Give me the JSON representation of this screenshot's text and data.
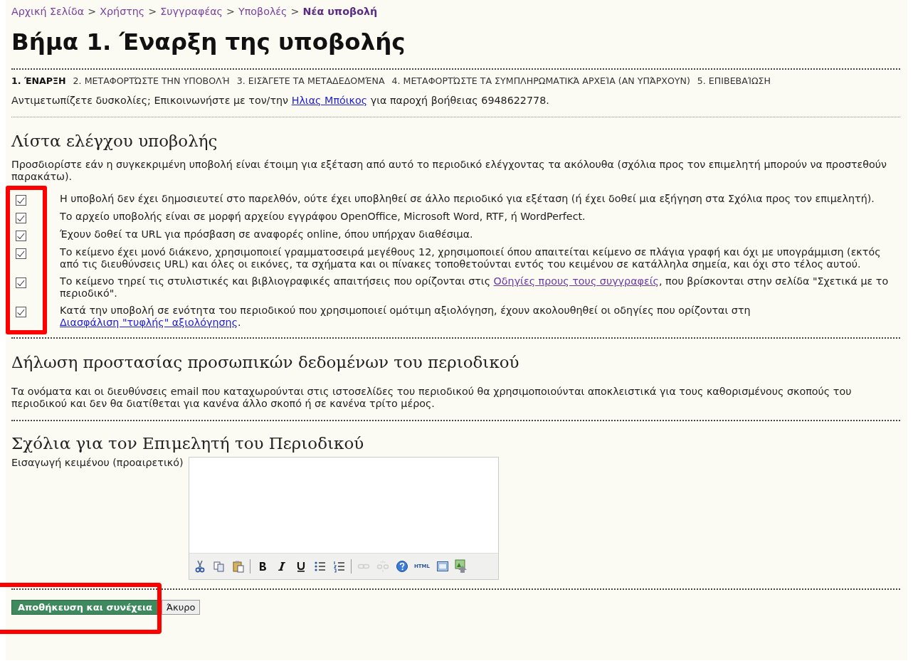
{
  "breadcrumb": [
    {
      "label": "Αρχική Σελίδα",
      "current": false
    },
    {
      "label": "Χρήστης",
      "current": false
    },
    {
      "label": "Συγγραφέας",
      "current": false
    },
    {
      "label": "Υποβολές",
      "current": false
    },
    {
      "label": "Νέα υποβολή",
      "current": true
    }
  ],
  "breadcrumb_separator": ">",
  "title": "Βήμα 1. Έναρξη της υποβολής",
  "steps": [
    {
      "label": "1. ΈΝΑΡΞΗ",
      "selected": true
    },
    {
      "label": "2. ΜΕΤΑΦΟΡΤΏΣΤΕ ΤΗΝ ΥΠΟΒΟΛΉ",
      "selected": false
    },
    {
      "label": "3. ΕΙΣΆΓΕΤΕ ΤΑ ΜΕΤΑΔΕΔΟΜΈΝΑ",
      "selected": false
    },
    {
      "label": "4. ΜΕΤΑΦΟΡΤΏΣΤΕ ΤΑ ΣΥΜΠΛΗΡΩΜΑΤΙΚΆ ΑΡΧΕΊΑ (ΑΝ ΥΠΆΡΧΟΥΝ)",
      "selected": false
    },
    {
      "label": "5. ΕΠΙΒΕΒΑΊΩΣΗ",
      "selected": false
    }
  ],
  "help": {
    "before": "Αντιμετωπίζετε δυσκολίες; Επικοινωνήστε με τον/την",
    "link": "Ηλιας Μπόικος",
    "after": "για παροχή βοήθειας 6948622778."
  },
  "checklist": {
    "heading": "Λίστα ελέγχου υποβολής",
    "intro": "Προσδιορίστε εάν η συγκεκριμένη υποβολή είναι έτοιμη για εξέταση από αυτό το περιοδικό ελέγχοντας τα ακόλουθα (σχόλια προς τον επιμελητή μπορούν να προστεθούν παρακάτω).",
    "highlighted": true,
    "items": [
      {
        "checked": true,
        "before": "Η υποβολή δεν έχει δημοσιευτεί στο παρελθόν, ούτε έχει υποβληθεί σε άλλο περιοδικό για εξέταση (ή έχει δοθεί μια εξήγηση στα Σχόλια προς τον επιμελητή)."
      },
      {
        "checked": true,
        "before": "Το αρχείο υποβολής είναι σε μορφή αρχείου εγγράφου OpenOffice, Microsoft Word, RTF, ή WordPerfect."
      },
      {
        "checked": true,
        "before": "Έχουν δοθεί τα URL για πρόσβαση σε αναφορές online, όπου υπήρχαν διαθέσιμα."
      },
      {
        "checked": true,
        "before": "Το κείμενο έχει μονό διάκενο, χρησιμοποιεί γραμματοσειρά μεγέθους 12, χρησιμοποιεί όπου απαιτείται κείμενο σε πλάγια γραφή και όχι με υπογράμμιση (εκτός από τις διευθύνσεις URL) και όλες οι εικόνες, τα σχήματα και οι πίνακες τοποθετούνται εντός του κειμένου σε κατάλληλα σημεία, και όχι στο τέλος αυτού."
      },
      {
        "checked": true,
        "before": "Το κείμενο τηρεί τις στυλιστικές και βιβλιογραφικές απαιτήσεις που ορίζονται στις ",
        "link": "Οδηγίες πρους τους συγγραφείς",
        "visited": true,
        "after": ", που βρίσκονται στην σελίδα \"Σχετικά με το περιοδικό\"."
      },
      {
        "checked": true,
        "before": "Κατά την υποβολή σε ενότητα του περιοδικού που χρησιμοποιεί ομότιμη αξιολόγηση, έχουν ακολουθηθεί οι οδηγίες που ορίζονται στη ",
        "link": "Διασφάλιση \"τυφλής\" αξιολόγησης",
        "visited": false,
        "after": "."
      }
    ]
  },
  "privacy": {
    "heading": "Δήλωση προστασίας προσωπικών δεδομένων του περιοδικού",
    "text": "Τα ονόματα και οι διευθύνσεις email που καταχωρούνται στις ιστοσελίδες του περιοδικού θα χρησιμοποιούνται αποκλειστικά για τους καθορισμένους σκοπούς του περιοδικού και δεν θα διατίθεται για κανένα άλλο σκοπό ή σε κανένα τρίτο μέρος."
  },
  "comments": {
    "heading": "Σχόλια για τον Επιμελητή του Περιοδικού",
    "label": "Εισαγωγή κειμένου (προαιρετικό)",
    "toolbar": [
      {
        "kind": "cut",
        "disabled": false
      },
      {
        "kind": "copy",
        "disabled": false
      },
      {
        "kind": "paste",
        "disabled": false
      },
      {
        "kind": "separator"
      },
      {
        "kind": "bold",
        "disabled": false
      },
      {
        "kind": "italic",
        "disabled": false
      },
      {
        "kind": "underline",
        "disabled": false
      },
      {
        "kind": "bullets",
        "disabled": false
      },
      {
        "kind": "numbers",
        "disabled": false
      },
      {
        "kind": "separator"
      },
      {
        "kind": "link",
        "disabled": true
      },
      {
        "kind": "unlink",
        "disabled": true
      },
      {
        "kind": "help",
        "disabled": false
      },
      {
        "kind": "html",
        "label": "HTML",
        "disabled": false
      },
      {
        "kind": "fullscreen",
        "disabled": false
      },
      {
        "kind": "image",
        "disabled": false
      }
    ]
  },
  "buttons": [
    {
      "label": "Αποθήκευση και συνέχεια",
      "primary": true,
      "highlighted": true
    },
    {
      "label": "Άκυρο",
      "primary": false,
      "highlighted": false
    }
  ]
}
